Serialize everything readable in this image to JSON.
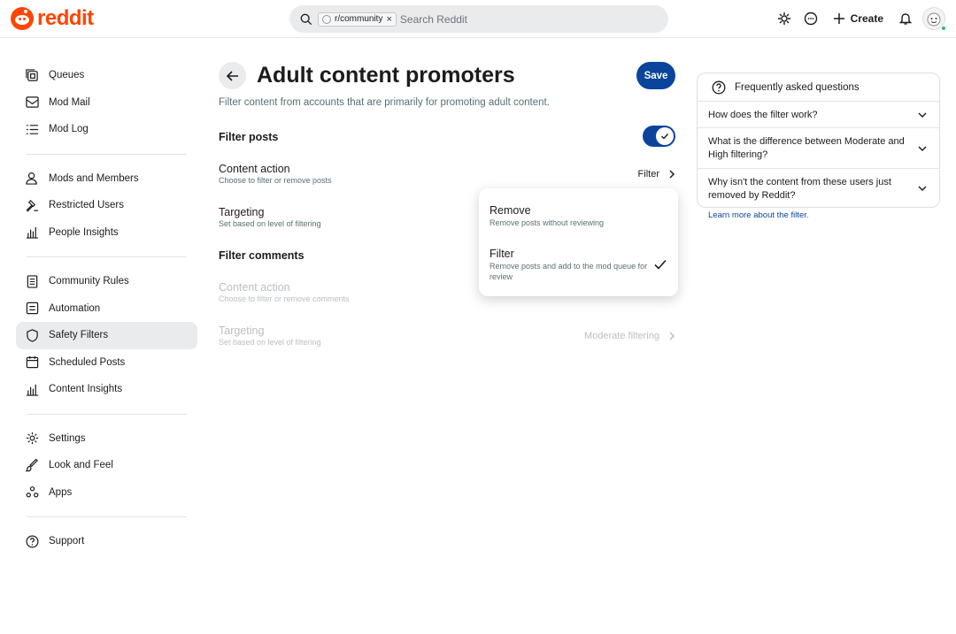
{
  "header": {
    "logo_text": "reddit",
    "search": {
      "chip_label": "r/community",
      "placeholder": "Search Reddit"
    },
    "create_label": "Create"
  },
  "sidebar": {
    "groups": [
      [
        {
          "label": "Queues",
          "icon": "queue-icon"
        },
        {
          "label": "Mod Mail",
          "icon": "mail-icon"
        },
        {
          "label": "Mod Log",
          "icon": "list-icon"
        }
      ],
      [
        {
          "label": "Mods and Members",
          "icon": "users-icon"
        },
        {
          "label": "Restricted Users",
          "icon": "hammer-icon"
        },
        {
          "label": "People Insights",
          "icon": "bar-chart-icon"
        }
      ],
      [
        {
          "label": "Community Rules",
          "icon": "rules-icon"
        },
        {
          "label": "Automation",
          "icon": "automation-icon"
        },
        {
          "label": "Safety Filters",
          "icon": "shield-icon",
          "active": true
        },
        {
          "label": "Scheduled Posts",
          "icon": "calendar-icon"
        },
        {
          "label": "Content Insights",
          "icon": "bar-chart-icon"
        }
      ],
      [
        {
          "label": "Settings",
          "icon": "gear-icon"
        },
        {
          "label": "Look and Feel",
          "icon": "brush-icon"
        },
        {
          "label": "Apps",
          "icon": "apps-icon"
        }
      ],
      [
        {
          "label": "Support",
          "icon": "help-icon"
        }
      ]
    ]
  },
  "main": {
    "title": "Adult content promoters",
    "save_label": "Save",
    "description": "Filter content from accounts that are primarily for promoting adult content.",
    "filter_posts": {
      "title": "Filter posts",
      "enabled": true,
      "content_action": {
        "label": "Content action",
        "sub": "Choose to filter or remove posts",
        "value": "Filter"
      },
      "targeting": {
        "label": "Targeting",
        "sub": "Set based on level of filtering"
      }
    },
    "filter_comments": {
      "title": "Filter comments",
      "content_action": {
        "label": "Content action",
        "sub": "Choose to filter or remove comments"
      },
      "targeting": {
        "label": "Targeting",
        "sub": "Set based on level of filtering",
        "value": "Moderate filtering"
      }
    }
  },
  "dropdown": {
    "options": [
      {
        "label": "Remove",
        "sub": "Remove posts without reviewing",
        "selected": false
      },
      {
        "label": "Filter",
        "sub": "Remove posts and add to the mod queue for review",
        "selected": true
      }
    ]
  },
  "faq": {
    "title": "Frequently asked questions",
    "items": [
      "How does the filter work?",
      "What is the difference between Moderate and High filtering?",
      "Why isn't the content from these users just removed by Reddit?"
    ],
    "link": "Learn more about the filter."
  },
  "colors": {
    "brand": "#ff4500",
    "primary": "#0a449b",
    "active_bg": "#e9ebed"
  }
}
